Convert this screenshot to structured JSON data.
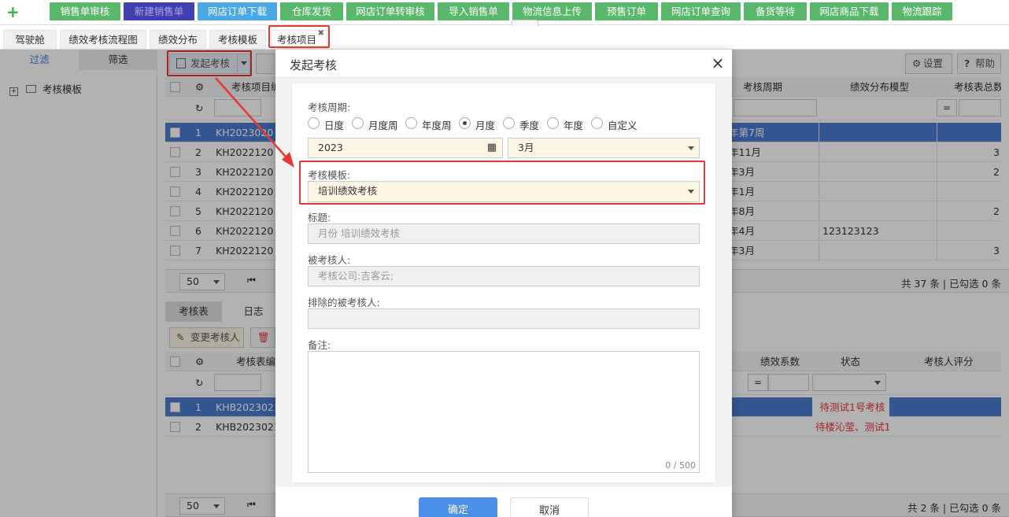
{
  "topnav": {
    "buttons": [
      "销售单审核",
      "新建销售单",
      "网店订单下载",
      "仓库发货",
      "网店订单转审核",
      "导入销售单",
      "物流信息上传",
      "预售订单",
      "网店订单查询",
      "备货等待",
      "网店商品下载",
      "物流跟踪"
    ]
  },
  "tabs": [
    "驾驶舱",
    "绩效考核流程图",
    "绩效分布",
    "考核模板",
    "考核项目"
  ],
  "left": {
    "tab_filter": "过滤",
    "tab_select": "筛选",
    "tree_item": "考核模板"
  },
  "toolbar": {
    "launch": "发起考核",
    "settings": "设置",
    "help": "帮助"
  },
  "upper_grid": {
    "headers": {
      "item_no": "考核项目编",
      "period": "考核周期",
      "dist_model": "绩效分布模型",
      "total": "考核表总数"
    },
    "rows": [
      {
        "n": "1",
        "code": "KH2023020",
        "period": "年第7周",
        "model": "",
        "total": ""
      },
      {
        "n": "2",
        "code": "KH2022120",
        "period": "年11月",
        "model": "",
        "total": "3"
      },
      {
        "n": "3",
        "code": "KH2022120",
        "period": "年3月",
        "model": "",
        "total": "2"
      },
      {
        "n": "4",
        "code": "KH2022120",
        "period": "年1月",
        "model": "",
        "total": ""
      },
      {
        "n": "5",
        "code": "KH2022120",
        "period": "年8月",
        "model": "",
        "total": "2"
      },
      {
        "n": "6",
        "code": "KH2022120",
        "period": "年4月",
        "model": "123123123",
        "total": ""
      },
      {
        "n": "7",
        "code": "KH2022120",
        "period": "年3月",
        "model": "",
        "total": "3"
      }
    ],
    "eq": "=",
    "page_size": "50",
    "summary": "共 37 条 | 已勾选 0 条"
  },
  "lower": {
    "tab_sheet": "考核表",
    "tab_log": "日志",
    "change_btn": "变更考核人",
    "headers": {
      "sheet_no": "考核表编号",
      "coef": "绩效系数",
      "status": "状态",
      "rating": "考核人评分"
    },
    "rows": [
      {
        "n": "1",
        "code": "KHB2023021",
        "status": "待测试1号考核"
      },
      {
        "n": "2",
        "code": "KHB2023021",
        "status": "待楼沁莹、测试1"
      }
    ],
    "eq": "=",
    "page_size": "50",
    "summary": "共 2 条 | 已勾选 0 条"
  },
  "modal": {
    "title": "发起考核",
    "close": "×",
    "period_label": "考核周期:",
    "period_options": [
      "日度",
      "月度周",
      "年度周",
      "月度",
      "季度",
      "年度",
      "自定义"
    ],
    "period_selected": "月度",
    "year": "2023",
    "month": "3月",
    "template_label": "考核模板:",
    "template_value": "培训绩效考核",
    "title_label": "标题:",
    "title_placeholder": "月份 培训绩效考核",
    "assessee_label": "被考核人:",
    "assessee_placeholder": "考核公司:吉客云;",
    "excluded_label": "排除的被考核人:",
    "remark_label": "备注:",
    "char_count": "0 / 500",
    "ok": "确定",
    "cancel": "取消"
  },
  "colors": {
    "nav_green": "#59b86b",
    "nav_dark": "#3f3fb0",
    "nav_blue": "#4aa8e6",
    "highlight_red": "#e53935",
    "primary": "#4a8fe8",
    "selected_row": "#4a7bd0",
    "status_red": "#e53935"
  }
}
